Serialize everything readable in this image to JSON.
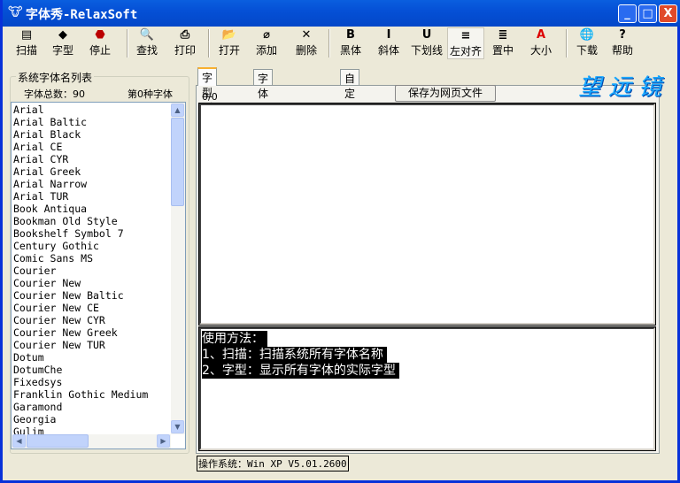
{
  "window": {
    "title": "字体秀-RelaxSoft",
    "icon": "cow-icon",
    "minimize": "_",
    "maximize": "□",
    "close": "X"
  },
  "toolbar": [
    {
      "label": "扫描",
      "icon": "scanner-icon",
      "glyph": "▤"
    },
    {
      "label": "字型",
      "icon": "shapes-icon",
      "glyph": "◆"
    },
    {
      "label": "停止",
      "icon": "stop-icon",
      "glyph": "⬣"
    },
    {
      "label": "查找",
      "icon": "find-icon",
      "glyph": "🔍"
    },
    {
      "label": "打印",
      "icon": "printer-icon",
      "glyph": "⎙"
    },
    {
      "label": "打开",
      "icon": "open-folder-icon",
      "glyph": "📂"
    },
    {
      "label": "添加",
      "icon": "paperclip-icon",
      "glyph": "⌀"
    },
    {
      "label": "删除",
      "icon": "delete-x-icon",
      "glyph": "✕"
    },
    {
      "label": "黑体",
      "icon": "bold-icon",
      "glyph": "B"
    },
    {
      "label": "斜体",
      "icon": "italic-icon",
      "glyph": "I"
    },
    {
      "label": "下划线",
      "icon": "underline-icon",
      "glyph": "U"
    },
    {
      "label": "左对齐",
      "icon": "align-left-icon",
      "glyph": "≡"
    },
    {
      "label": "置中",
      "icon": "align-center-icon",
      "glyph": "≣"
    },
    {
      "label": "大小",
      "icon": "font-size-icon",
      "glyph": "A"
    },
    {
      "label": "下载",
      "icon": "download-icon",
      "glyph": "🌐"
    },
    {
      "label": "帮助",
      "icon": "help-icon",
      "glyph": "?"
    }
  ],
  "sidebar": {
    "group_title": "系统字体名列表",
    "total_label": "字体总数：90",
    "current_label": "第0种字体",
    "fonts": [
      "Arial",
      "Arial Baltic",
      "Arial Black",
      "Arial CE",
      "Arial CYR",
      "Arial Greek",
      "Arial Narrow",
      "Arial TUR",
      "Book Antiqua",
      "Bookman Old Style",
      "Bookshelf Symbol 7",
      "Century Gothic",
      "Comic Sans MS",
      "Courier",
      "Courier New",
      "Courier New Baltic",
      "Courier New CE",
      "Courier New CYR",
      "Courier New Greek",
      "Courier New TUR",
      "Dotum",
      "DotumChe",
      "Fixedsys",
      "Franklin Gothic Medium",
      "Garamond",
      "Georgia",
      "Gulim"
    ]
  },
  "tabs": [
    {
      "label": "字型列表",
      "active": true
    },
    {
      "label": "字体文件名列表"
    },
    {
      "label": "自定义"
    }
  ],
  "main": {
    "counter": "0/0",
    "save_button": "保存为网页文件",
    "help_lines": [
      "使用方法：",
      "1、扫描：扫描系统所有字体名称 ",
      "2、字型：显示所有字体的实际字型"
    ]
  },
  "logo": "望远镜",
  "status": "操作系统：Win XP V5.01.2600"
}
